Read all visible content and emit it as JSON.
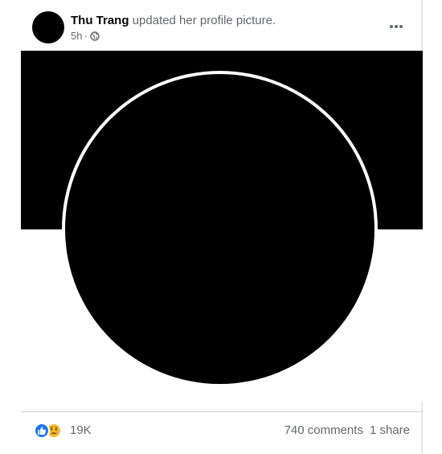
{
  "post": {
    "author": "Thu Trang",
    "action": "updated her profile picture.",
    "time": "5h",
    "separator": "·",
    "audience_icon": "globe-icon",
    "more_icon": "more-options-icon"
  },
  "reactions": {
    "icons": [
      "like-icon",
      "sad-icon"
    ],
    "count": "19K"
  },
  "stats": {
    "comments": "740 comments",
    "shares": "1 share"
  },
  "colors": {
    "like_blue": "#1877f2",
    "sad_yellow": "#f7b928",
    "secondary_text": "#65676b",
    "primary_text": "#050505"
  }
}
